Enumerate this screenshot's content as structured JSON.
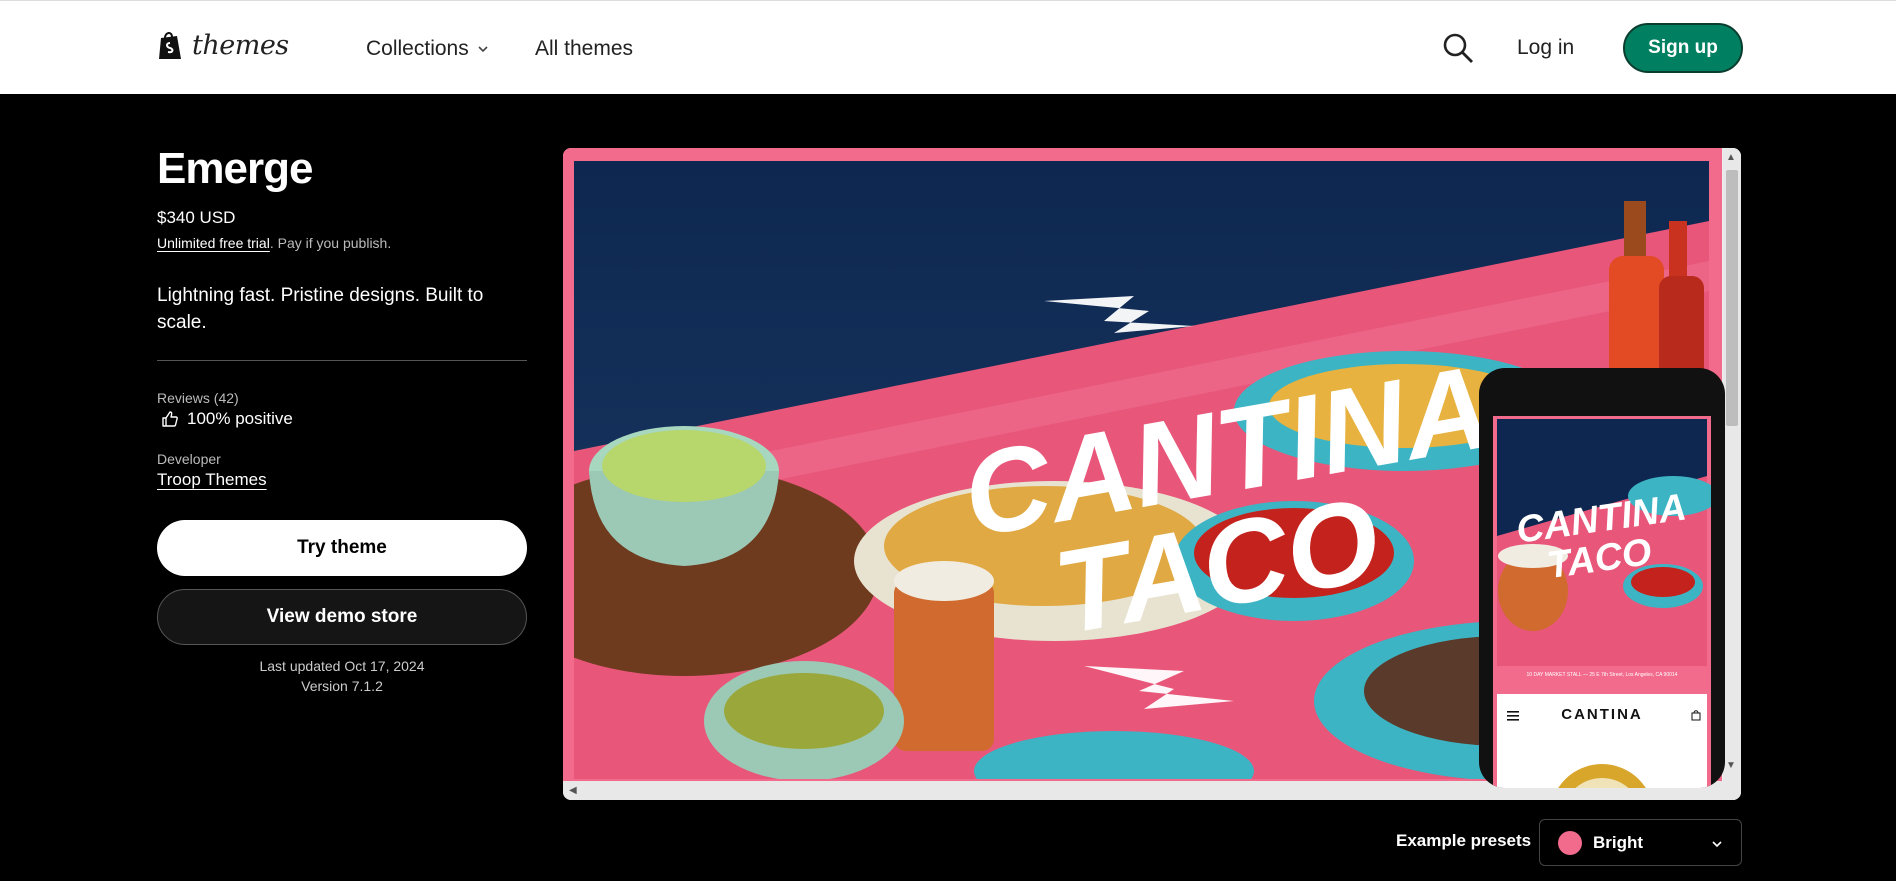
{
  "nav": {
    "logo_text": "themes",
    "collections_label": "Collections",
    "all_themes_label": "All themes",
    "login_label": "Log in",
    "signup_label": "Sign up"
  },
  "theme": {
    "name": "Emerge",
    "price": "$340 USD",
    "trial_link": "Unlimited free trial",
    "trial_note": ". Pay if you publish.",
    "tagline": "Lightning fast. Pristine designs. Built to scale.",
    "reviews_label": "Reviews (42)",
    "positive_label": "100% positive",
    "developer_label": "Developer",
    "developer_name": "Troop Themes",
    "try_label": "Try theme",
    "demo_label": "View demo store",
    "last_updated": "Last updated Oct 17, 2024",
    "version": "Version 7.1.2"
  },
  "preview": {
    "hero_line1": "CANTINA",
    "hero_line2": "TACO",
    "phone_strip": "10 DAY MARKET STALL — 25 E 7th Street, Los Angeles, CA 90014",
    "phone_brand": "CANTINA"
  },
  "presets": {
    "label": "Example presets",
    "selected": "Bright"
  },
  "colors": {
    "accent_green": "#008060",
    "preset_pink": "#f26b8c"
  },
  "icons": [
    "shopify-bag-icon",
    "chevron-down-icon",
    "search-icon",
    "thumbs-up-icon",
    "scroll-up-icon",
    "scroll-down-icon",
    "scroll-left-icon",
    "menu-icon",
    "bag-icon"
  ]
}
